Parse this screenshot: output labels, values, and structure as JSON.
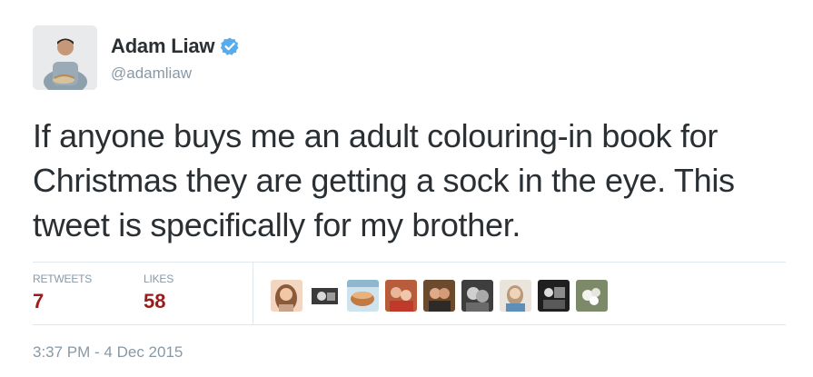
{
  "author": {
    "display_name": "Adam Liaw",
    "handle": "@adamliaw",
    "verified_icon": "verified-badge-icon",
    "verified_color": "#55acee"
  },
  "tweet": {
    "text": "If anyone buys me an adult colouring-in book for Christmas they are getting a sock in the eye. This tweet is specifically for my brother."
  },
  "stats": {
    "retweets_label": "RETWEETS",
    "retweets_count": "7",
    "likes_label": "LIKES",
    "likes_count": "58",
    "count_color": "#9b1b1b"
  },
  "likers_count_shown": 9,
  "timestamp": "3:37 PM - 4 Dec 2015"
}
